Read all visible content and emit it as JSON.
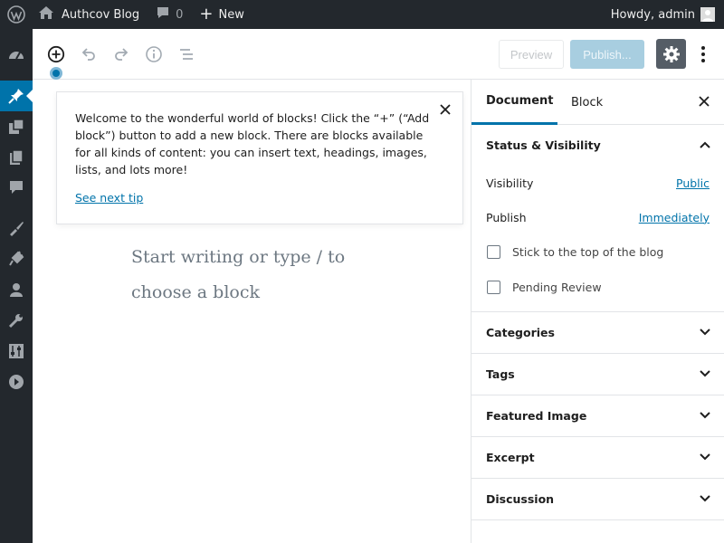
{
  "adminbar": {
    "site_name": "Authcov Blog",
    "comment_count": "0",
    "new_label": "New",
    "howdy": "Howdy, admin"
  },
  "menu_icons": [
    "dashboard-icon",
    "posts-icon",
    "media-icon",
    "pages-icon",
    "comments-icon",
    "appearance-icon",
    "plugins-icon",
    "users-icon",
    "tools-icon",
    "settings-icon",
    "collapse-icon"
  ],
  "toolbar": {
    "preview_label": "Preview",
    "publish_label": "Publish..."
  },
  "tip": {
    "text": "Welcome to the wonderful world of blocks! Click the “+” (“Add block”) button to add a new block. There are blocks available for all kinds of content: you can insert text, headings, images, lists, and lots more!",
    "link": "See next tip"
  },
  "editor": {
    "placeholder": "Start writing or type / to choose a block"
  },
  "sidebar": {
    "tabs": [
      "Document",
      "Block"
    ],
    "status_panel": {
      "title": "Status & Visibility",
      "visibility_label": "Visibility",
      "visibility_value": "Public",
      "publish_label": "Publish",
      "publish_value": "Immediately",
      "stick_label": "Stick to the top of the blog",
      "pending_label": "Pending Review"
    },
    "panels": [
      "Categories",
      "Tags",
      "Featured Image",
      "Excerpt",
      "Discussion"
    ]
  },
  "colors": {
    "adminbar_bg": "#23282d",
    "accent": "#0073aa",
    "publish_disabled": "#a8cee0"
  }
}
